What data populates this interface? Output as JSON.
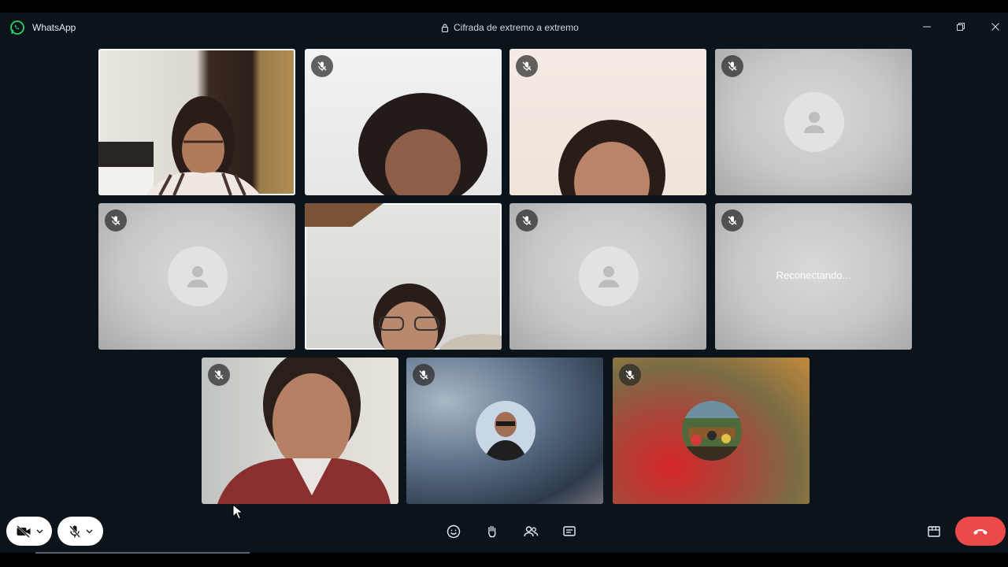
{
  "app": {
    "name": "WhatsApp",
    "encryption_label": "Cifrada de extremo a extremo"
  },
  "window_controls": [
    "minimize-icon",
    "restore-icon",
    "close-icon"
  ],
  "tiles": [
    {
      "kind": "video",
      "muted": false,
      "selected": true
    },
    {
      "kind": "video",
      "muted": true,
      "selected": false
    },
    {
      "kind": "video",
      "muted": true,
      "selected": false
    },
    {
      "kind": "no-video",
      "muted": true,
      "selected": false
    },
    {
      "kind": "no-video",
      "muted": true,
      "selected": false
    },
    {
      "kind": "video",
      "muted": false,
      "selected": true
    },
    {
      "kind": "no-video",
      "muted": true,
      "selected": false
    },
    {
      "kind": "reconnecting",
      "muted": true,
      "selected": false,
      "status": "Reconectando..."
    },
    {
      "kind": "video",
      "muted": true,
      "selected": false
    },
    {
      "kind": "photo-avatar",
      "muted": true,
      "selected": false
    },
    {
      "kind": "photo-avatar",
      "muted": true,
      "selected": false
    }
  ],
  "controls": {
    "left": [
      "camera-off-icon",
      "mic-off-icon"
    ],
    "center": [
      "emoji-icon",
      "raise-hand-icon",
      "participants-icon",
      "chat-icon"
    ],
    "right": [
      "layout-icon",
      "end-call-icon"
    ]
  },
  "colors": {
    "background": "#0b141a",
    "end_call": "#ea4a4a",
    "tile_placeholder": "#c7c7c7"
  }
}
